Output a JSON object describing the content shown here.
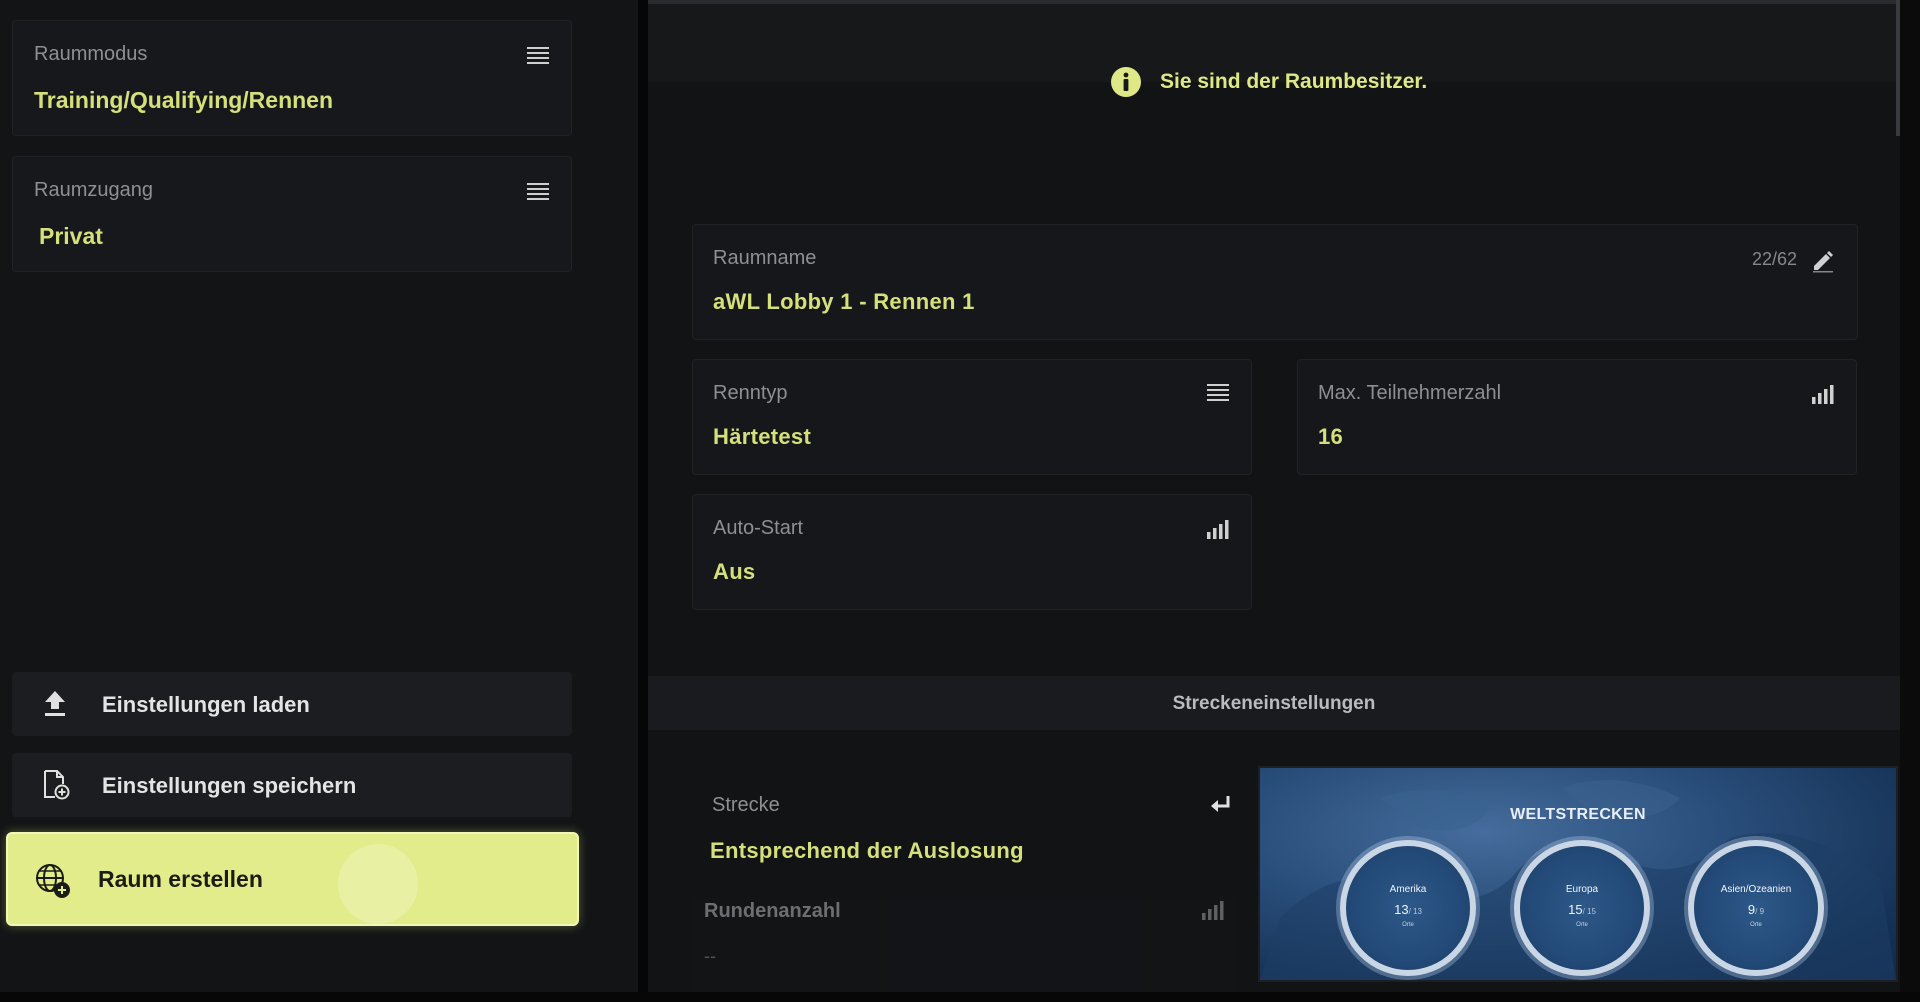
{
  "sidebar": {
    "room_mode": {
      "label": "Raummodus",
      "value": "Training/Qualifying/Rennen"
    },
    "room_access": {
      "label": "Raumzugang",
      "value": "Privat"
    },
    "load_settings_label": "Einstellungen laden",
    "save_settings_label": "Einstellungen speichern",
    "create_room_label": "Raum erstellen"
  },
  "notice": {
    "text": "Sie sind der Raumbesitzer."
  },
  "room_name": {
    "label": "Raumname",
    "value": "aWL Lobby 1 - Rennen 1",
    "char_count": "22/62"
  },
  "race_type": {
    "label": "Renntyp",
    "value": "Härtetest"
  },
  "max_participants": {
    "label": "Max. Teilnehmerzahl",
    "value": "16"
  },
  "auto_start": {
    "label": "Auto-Start",
    "value": "Aus"
  },
  "track_settings": {
    "section_label": "Streckeneinstellungen",
    "track": {
      "label": "Strecke",
      "value": "Entsprechend der Auslosung"
    },
    "laps": {
      "label": "Rundenanzahl",
      "value": "--"
    }
  },
  "world_tracks": {
    "title": "WELTSTRECKEN",
    "regions": [
      {
        "name": "Amerika",
        "count": "13",
        "total": "/ 13",
        "unit": "Orte"
      },
      {
        "name": "Europa",
        "count": "15",
        "total": "/ 15",
        "unit": "Orte"
      },
      {
        "name": "Asien/Ozeanien",
        "count": "9",
        "total": "/ 9",
        "unit": "Orte"
      }
    ]
  },
  "colors": {
    "accent": "#d6e07b",
    "primary_button": "#e2ec8a",
    "background": "#121315"
  }
}
